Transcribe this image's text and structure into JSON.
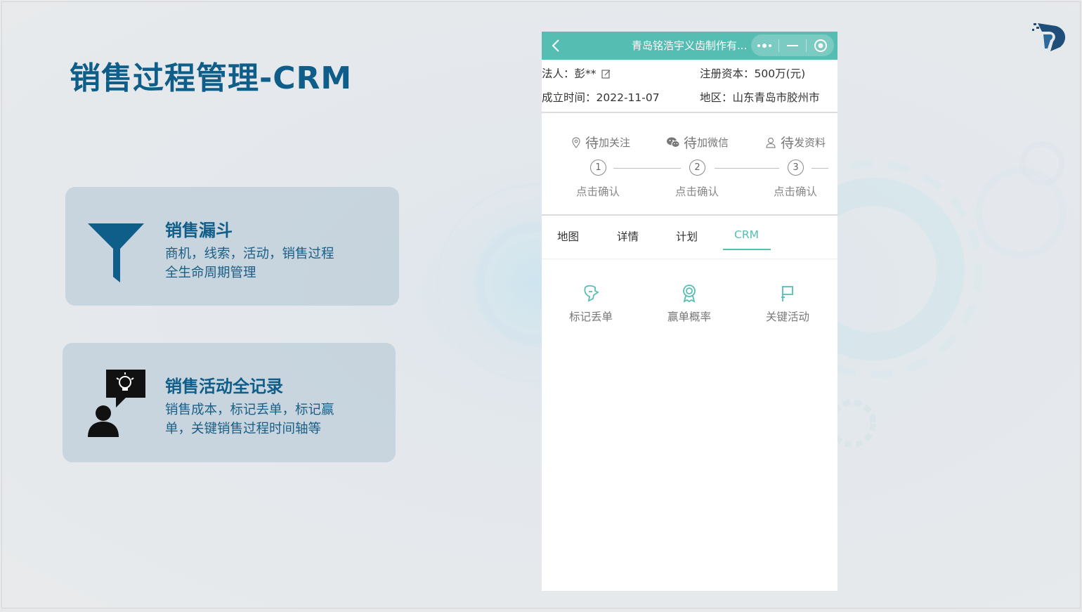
{
  "slide": {
    "title": "销售过程管理-CRM"
  },
  "cards": [
    {
      "title": "销售漏斗",
      "desc_line1": "商机，线索，活动，销售过程",
      "desc_line2": "全生命周期管理",
      "icon": "funnel-icon"
    },
    {
      "title": "销售活动全记录",
      "desc_line1": "销售成本，标记丢单，标记赢",
      "desc_line2": "单，关键销售过程时间轴等",
      "icon": "person-idea-icon"
    }
  ],
  "phone": {
    "nav": {
      "title": "青岛铭浩宇义齿制作有...",
      "accent": "#56bdb2"
    },
    "info": {
      "legal_label": "法人：",
      "legal_value": "彭**",
      "capital_label": "注册资本：",
      "capital_value": "500万(元)",
      "founded_label": "成立时间：",
      "founded_value": "2022-11-07",
      "region_label": "地区：",
      "region_value": "山东青岛市胶州市"
    },
    "steps": [
      {
        "big": "待",
        "small": "加关注",
        "num": "1",
        "confirm": "点击确认",
        "icon": "location-icon"
      },
      {
        "big": "待",
        "small": "加微信",
        "num": "2",
        "confirm": "点击确认",
        "icon": "wechat-icon"
      },
      {
        "big": "待",
        "small": "发资料",
        "num": "3",
        "confirm": "点击确认",
        "icon": "user-icon"
      }
    ],
    "tabs": [
      "地图",
      "详情",
      "计划",
      "CRM"
    ],
    "active_tab": "CRM",
    "actions": [
      {
        "label": "标记丢单",
        "icon": "hand-mark-icon"
      },
      {
        "label": "赢单概率",
        "icon": "medal-icon"
      },
      {
        "label": "关键活动",
        "icon": "flag-icon"
      }
    ]
  }
}
